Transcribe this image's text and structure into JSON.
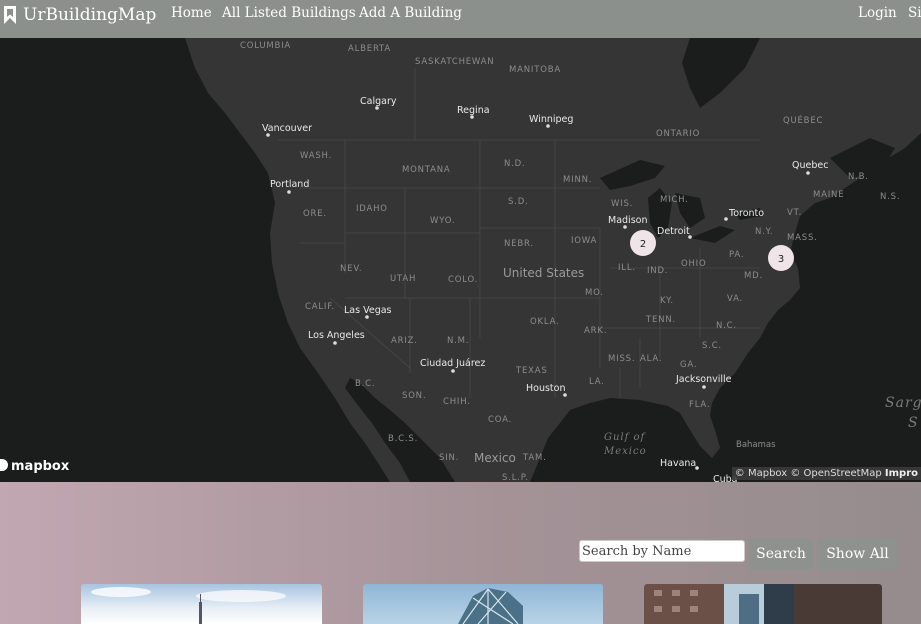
{
  "navbar": {
    "brand": "UrBuildingMap",
    "links": [
      "Home",
      "All Listed Buildings",
      "Add A Building"
    ],
    "login": "Login",
    "signup_partial": "Si"
  },
  "map": {
    "provider_logo": "mapbox",
    "attribution": "© Mapbox © OpenStreetMap",
    "attribution_improve": "Impro",
    "labels": {
      "columbia": "COLUMBIA",
      "alberta": "ALBERTA",
      "saskatchewan": "SASKATCHEWAN",
      "manitoba": "MANITOBA",
      "ontario": "ONTARIO",
      "quebec_prov": "QUÉBEC",
      "wash": "WASH.",
      "montana": "MONTANA",
      "nd": "N.D.",
      "minn": "MINN.",
      "ore": "ORE.",
      "idaho": "IDAHO",
      "wyo": "WYO.",
      "sd": "S.D.",
      "wis": "WIS.",
      "mich": "MICH.",
      "maine": "MAINE",
      "nb": "N.B.",
      "ns": "N.S.",
      "vt": "VT.",
      "ny": "N.Y.",
      "mass": "MASS.",
      "nebr": "NEBR.",
      "iowa": "IOWA",
      "nev": "NEV.",
      "utah": "UTAH",
      "colo": "COLO.",
      "ill": "ILL.",
      "ind": "IND.",
      "ohio": "OHIO",
      "pa": "PA.",
      "md": "MD.",
      "calif": "CALIF.",
      "mo": "MO.",
      "ky": "KY.",
      "va": "VA.",
      "okla": "OKLA.",
      "tenn": "TENN.",
      "nc": "N.C.",
      "ariz": "ARIZ.",
      "nm": "N.M.",
      "ark": "ARK.",
      "sc": "S.C.",
      "texas": "TEXAS",
      "miss": "MISS.",
      "ala": "ALA.",
      "ga": "GA.",
      "bc": "B.C.",
      "son": "SON.",
      "chih": "CHIH.",
      "coa": "COA.",
      "la": "LA.",
      "fla": "FLA.",
      "bcs": "B.C.S.",
      "sin": "SIN.",
      "tam": "TAM.",
      "slp": "S.L.P.",
      "bahamas": "Bahamas",
      "cuba": "Cuba",
      "gulf": "Gulf of",
      "mexico_water": "Mexico",
      "sarg": "Sarg",
      "sarg2": "S"
    },
    "big_labels": {
      "us": "United States",
      "mexico": "Mexico"
    },
    "cities": {
      "calgary": "Calgary",
      "regina": "Regina",
      "winnipeg": "Winnipeg",
      "vancouver": "Vancouver",
      "portland": "Portland",
      "quebec": "Quebec",
      "toronto": "Toronto",
      "madison": "Madison",
      "detroit": "Detroit",
      "las_vegas": "Las Vegas",
      "los_angeles": "Los Angeles",
      "ciudad_juarez": "Ciudad Juárez",
      "houston": "Houston",
      "jacksonville": "Jacksonville",
      "havana": "Havana"
    },
    "clusters": [
      {
        "count": "2"
      },
      {
        "count": "3"
      }
    ]
  },
  "search": {
    "placeholder": "Search by Name",
    "search_label": "Search",
    "show_all_label": "Show All"
  },
  "colors": {
    "navbar": "#8b908c",
    "map_bg": "#1b1c1c",
    "land": "#353535",
    "cluster": "#efe4e8",
    "button": "#8e928e"
  }
}
